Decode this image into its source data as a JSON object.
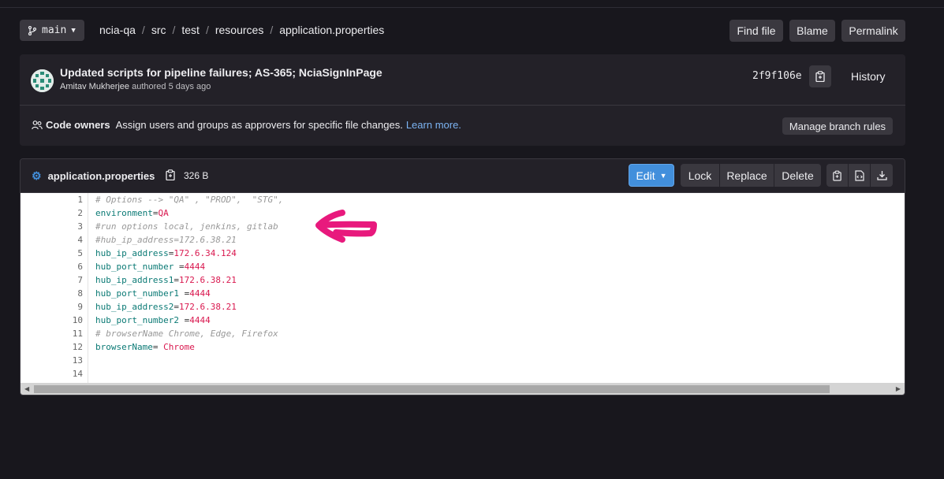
{
  "toolbar": {
    "branch": "main",
    "breadcrumbs": [
      "ncia-qa",
      "src",
      "test",
      "resources",
      "application.properties"
    ],
    "find_file": "Find file",
    "blame": "Blame",
    "permalink": "Permalink"
  },
  "commit": {
    "title": "Updated scripts for pipeline failures; AS-365; NciaSignInPage",
    "author": "Amitav Mukherjee",
    "authored": "authored 5 days ago",
    "sha": "2f9f106e",
    "history": "History"
  },
  "code_owners": {
    "label": "Code owners",
    "text": "Assign users and groups as approvers for specific file changes.",
    "link": "Learn more.",
    "manage": "Manage branch rules"
  },
  "file": {
    "name": "application.properties",
    "size": "326 B",
    "edit": "Edit",
    "lock": "Lock",
    "replace": "Replace",
    "delete": "Delete",
    "lines": [
      {
        "n": "1",
        "c": "# Options --> \"QA\" , \"PROD\",  \"STG\","
      },
      {
        "n": "2",
        "k": "environment",
        "s": "=",
        "v": "QA"
      },
      {
        "n": "3",
        "c": "#run options local, jenkins, gitlab"
      },
      {
        "n": "4",
        "c": "#hub_ip_address=172.6.38.21"
      },
      {
        "n": "5",
        "k": "hub_ip_address",
        "s": "=",
        "v": "172.6.34.124"
      },
      {
        "n": "6",
        "k": "hub_port_number ",
        "s": "=",
        "v": "4444"
      },
      {
        "n": "7",
        "k": "hub_ip_address1",
        "s": "=",
        "v": "172.6.38.21"
      },
      {
        "n": "8",
        "k": "hub_port_number1 ",
        "s": "=",
        "v": "4444"
      },
      {
        "n": "9",
        "k": "hub_ip_address2",
        "s": "=",
        "v": "172.6.38.21"
      },
      {
        "n": "10",
        "k": "hub_port_number2 ",
        "s": "=",
        "v": "4444"
      },
      {
        "n": "11",
        "c": "# browserName Chrome, Edge, Firefox"
      },
      {
        "n": "12",
        "k": "browserName",
        "s": "= ",
        "v": "Chrome"
      },
      {
        "n": "13"
      },
      {
        "n": "14"
      }
    ]
  },
  "colors": {
    "accent": "#428fdc",
    "annotation": "#e8197d"
  }
}
